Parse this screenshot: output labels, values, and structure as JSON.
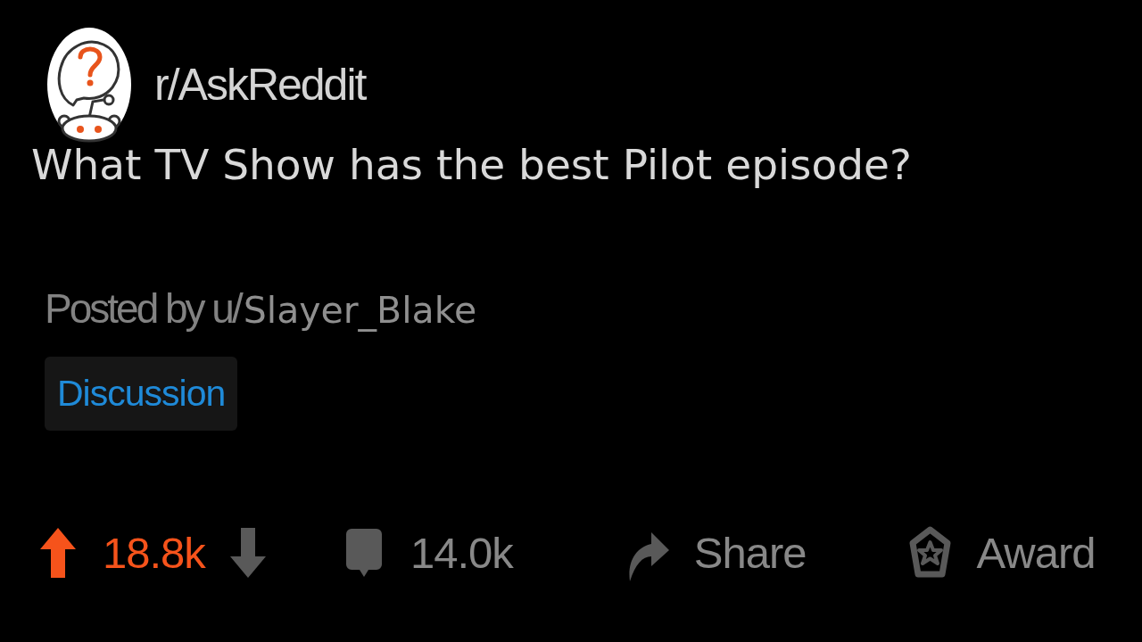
{
  "subreddit": {
    "name": "r/AskReddit"
  },
  "post": {
    "title": "What TV Show has the best Pilot episode?",
    "posted_by": "Posted by u/",
    "author": "Slayer_Blake",
    "flair": "Discussion"
  },
  "actions": {
    "upvoted": true,
    "downvoted": false,
    "score": "18.8k",
    "comments": "14.0k",
    "share": "Share",
    "award": "Award"
  }
}
